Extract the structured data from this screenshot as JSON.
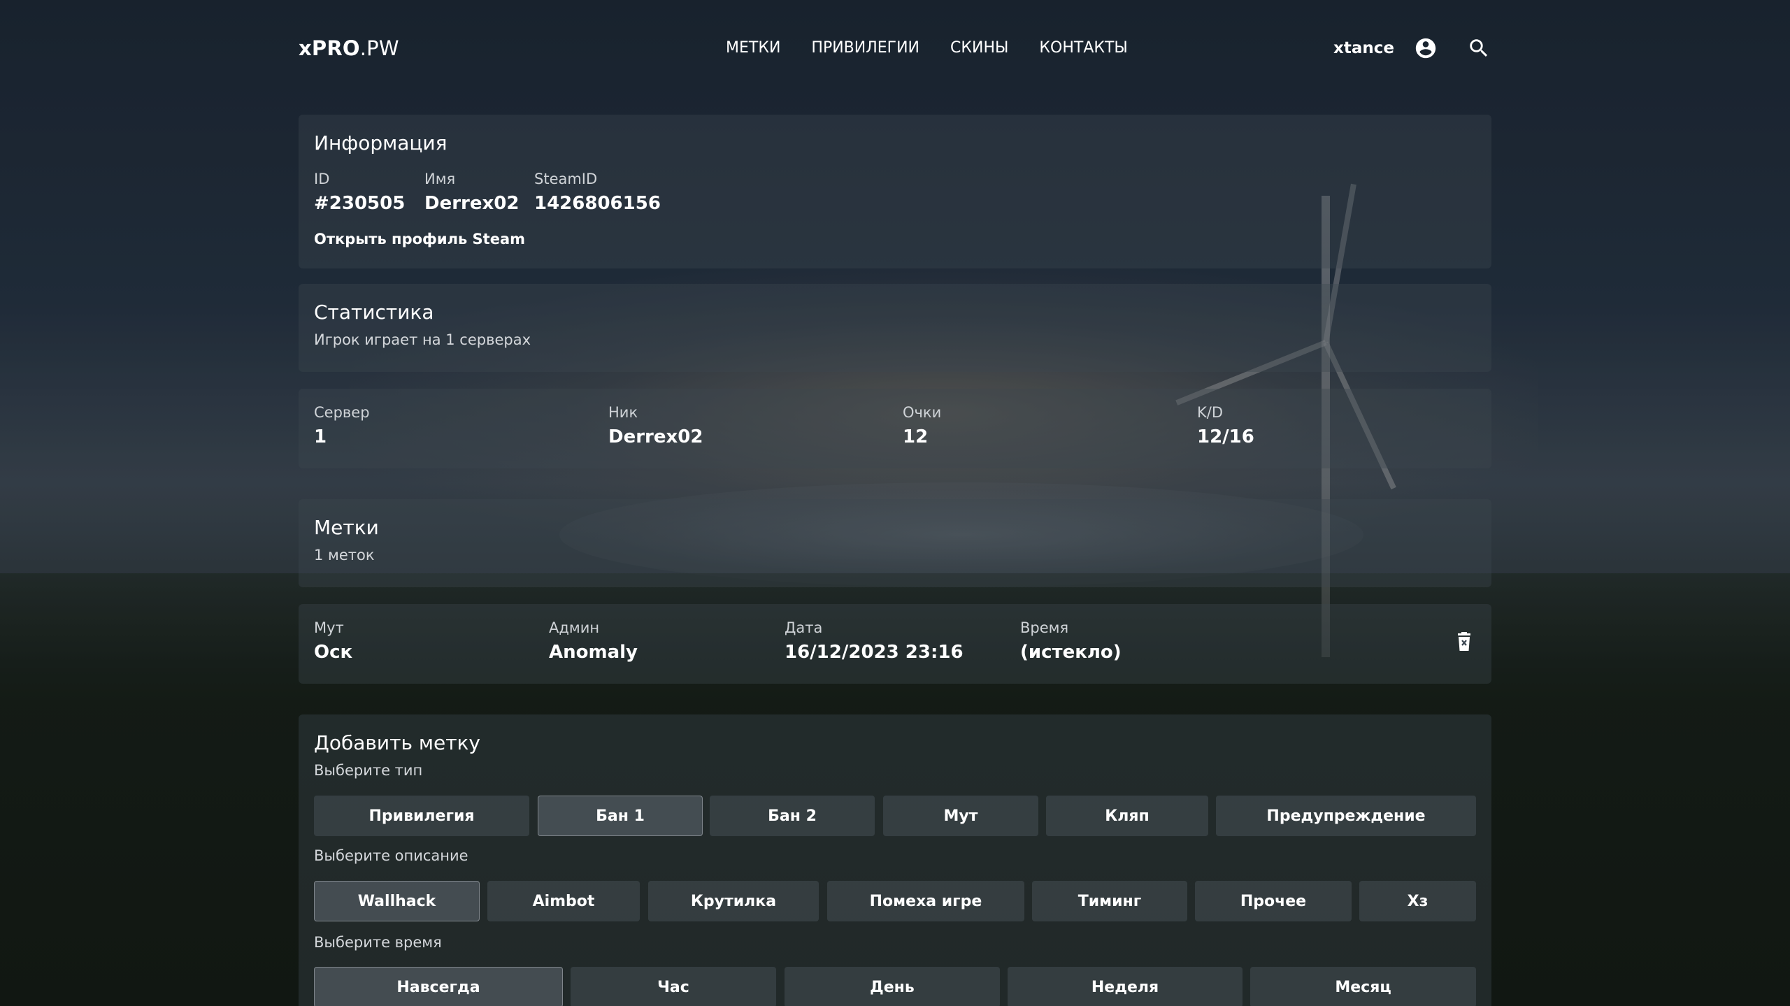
{
  "header": {
    "logo_bold": "xPRO",
    "logo_light": ".PW",
    "nav": [
      "МЕТКИ",
      "ПРИВИЛЕГИИ",
      "СКИНЫ",
      "КОНТАКТЫ"
    ],
    "username": "xtance",
    "icons": [
      "account-circle-icon",
      "search-icon"
    ]
  },
  "info": {
    "title": "Информация",
    "id_label": "ID",
    "id_value": "#230505",
    "name_label": "Имя",
    "name_value": "Derrex02",
    "steam_label": "SteamID",
    "steam_value": "1426806156",
    "steam_link": "Открыть профиль Steam"
  },
  "stats": {
    "title": "Статистика",
    "subtitle": "Игрок играет на 1 серверах",
    "row": {
      "server_label": "Сервер",
      "server_value": "1",
      "nick_label": "Ник",
      "nick_value": "Derrex02",
      "points_label": "Очки",
      "points_value": "12",
      "kd_label": "K/D",
      "kd_value": "12/16"
    }
  },
  "marks": {
    "title": "Метки",
    "subtitle": "1 меток",
    "row": {
      "type_label": "Мут",
      "type_value": "Оск",
      "admin_label": "Админ",
      "admin_value": "Anomaly",
      "date_label": "Дата",
      "date_value": "16/12/2023 23:16",
      "time_label": "Время",
      "time_value": "(истекло)",
      "delete_icon": "trash-icon"
    }
  },
  "add_mark": {
    "title": "Добавить метку",
    "type_prompt": "Выберите тип",
    "types": [
      "Привилегия",
      "Бан 1",
      "Бан 2",
      "Мут",
      "Кляп",
      "Предупреждение"
    ],
    "selected_type": "Бан 1",
    "desc_prompt": "Выберите описание",
    "descriptions": [
      "Wallhack",
      "Aimbot",
      "Крутилка",
      "Помеха игре",
      "Тиминг",
      "Прочее",
      "Хз"
    ],
    "selected_description": "Wallhack",
    "time_prompt": "Выберите время",
    "times": [
      "Навсегда",
      "Час",
      "День",
      "Неделя",
      "Месяц"
    ],
    "selected_time": "Навсегда"
  }
}
